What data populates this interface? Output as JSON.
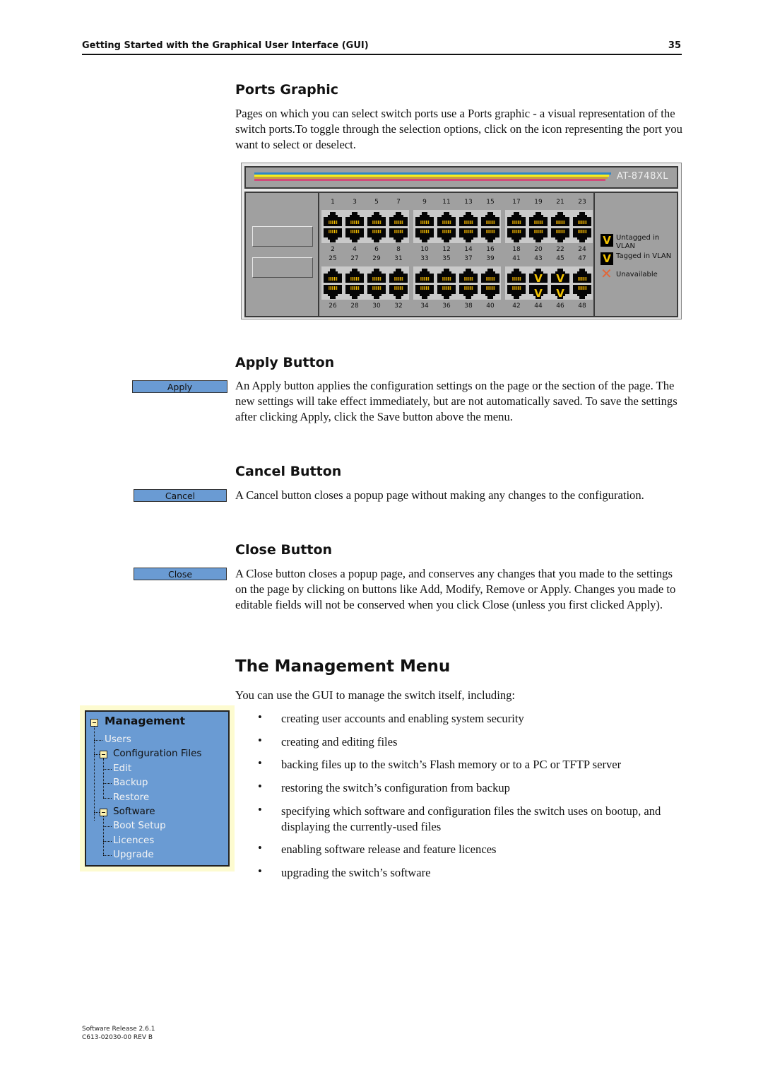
{
  "header": {
    "title": "Getting Started with the Graphical User Interface (GUI)",
    "page_number": "35"
  },
  "ports_section": {
    "heading": "Ports Graphic",
    "body": "Pages on which you can select switch ports use a Ports graphic - a visual representation of the switch ports.To toggle through the selection options, click on the icon representing the port you want to select or deselect.",
    "graphic": {
      "model": "AT-8748XL",
      "stripe_colors": [
        "#2f86c8",
        "#f7ef1c",
        "#c8a040",
        "#d24a7a"
      ],
      "odd_top_row": [
        "1",
        "3",
        "5",
        "7",
        "9",
        "11",
        "13",
        "15",
        "17",
        "19",
        "21",
        "23"
      ],
      "even_top_row": [
        "2",
        "4",
        "6",
        "8",
        "10",
        "12",
        "14",
        "16",
        "18",
        "20",
        "22",
        "24"
      ],
      "odd_bottom_row": [
        "25",
        "27",
        "29",
        "31",
        "33",
        "35",
        "37",
        "39",
        "41",
        "43",
        "45",
        "47"
      ],
      "even_bottom_row": [
        "26",
        "28",
        "30",
        "32",
        "34",
        "36",
        "38",
        "40",
        "42",
        "44",
        "46",
        "48"
      ],
      "untagged_ports": [
        "43",
        "44",
        "45",
        "46"
      ],
      "legend": [
        {
          "icon": "untagged-icon",
          "glyph": "V",
          "label": "Untagged in VLAN"
        },
        {
          "icon": "tagged-icon",
          "glyph": "V",
          "label": "Tagged in VLAN"
        },
        {
          "icon": "unavailable-icon",
          "glyph": "✕",
          "label": "Unavailable"
        }
      ]
    }
  },
  "apply_section": {
    "heading": "Apply Button",
    "button_label": "Apply",
    "body": "An Apply button applies the configuration settings on the page or the section of the page. The new settings will take effect immediately, but are not automatically saved. To save the settings after clicking Apply, click the Save button above the menu."
  },
  "cancel_section": {
    "heading": "Cancel Button",
    "button_label": "Cancel",
    "body": "A Cancel button closes a popup page without making any changes to the configuration."
  },
  "close_section": {
    "heading": "Close Button",
    "button_label": "Close",
    "body": "A Close button closes a popup page, and conserves any changes that you made to the settings on the page by clicking on buttons like Add, Modify, Remove or Apply. Changes you made to editable fields will not be conserved when you click Close (unless you first clicked Apply)."
  },
  "management_section": {
    "heading": "The Management Menu",
    "intro": "You can use the GUI to manage the switch itself, including:",
    "bullets": [
      "creating user accounts and enabling system security",
      "creating and editing files",
      "backing files up to the switch’s Flash memory or to a PC or TFTP server",
      "restoring the switch’s configuration from backup",
      "specifying which software and configuration files the switch uses on bootup, and displaying the currently-used files",
      "enabling software release and feature licences",
      "upgrading the switch’s software"
    ],
    "menu": {
      "root": "Management",
      "items": [
        {
          "label": "Users",
          "level": 1,
          "folder": false
        },
        {
          "label": "Configuration Files",
          "level": 1,
          "folder": true
        },
        {
          "label": "Edit",
          "level": 2,
          "folder": false
        },
        {
          "label": "Backup",
          "level": 2,
          "folder": false
        },
        {
          "label": "Restore",
          "level": 2,
          "folder": false
        },
        {
          "label": "Software",
          "level": 1,
          "folder": true
        },
        {
          "label": "Boot Setup",
          "level": 2,
          "folder": false
        },
        {
          "label": "Licences",
          "level": 2,
          "folder": false
        },
        {
          "label": "Upgrade",
          "level": 2,
          "folder": false
        }
      ]
    }
  },
  "footer": {
    "release": "Software Release 2.6.1",
    "doc_id": "C613-02030-00 REV B"
  }
}
